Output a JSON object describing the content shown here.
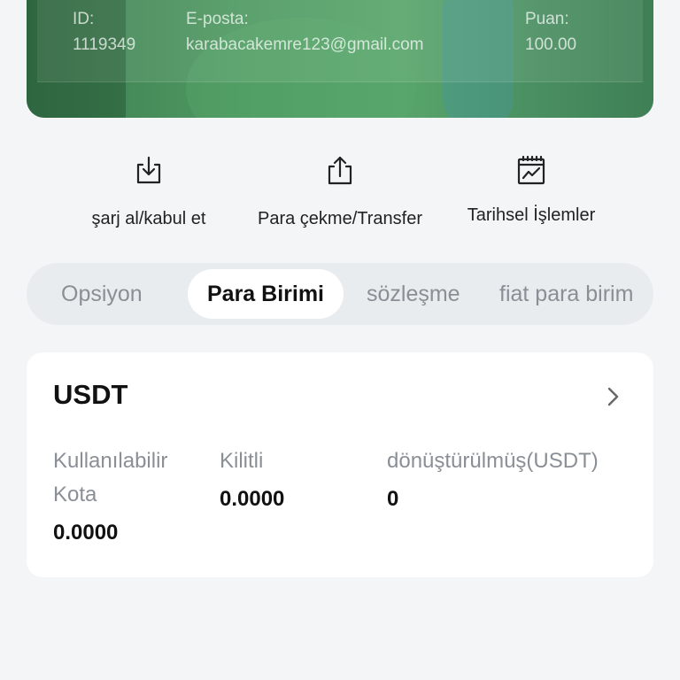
{
  "account": {
    "id_label": "ID:",
    "id_value": "1119349",
    "email_label": "E-posta:",
    "email_value": "karabacakemre123@gmail.com",
    "points_label": "Puan:",
    "points_value": "100.00"
  },
  "actions": [
    {
      "label": "şarj al/kabul et",
      "icon": "download-icon"
    },
    {
      "label": "Para çekme/Transfer",
      "icon": "upload-icon"
    },
    {
      "label": "Tarihsel İşlemler",
      "icon": "chart-calendar-icon"
    }
  ],
  "tabs": [
    {
      "label": "Opsiyon",
      "active": false
    },
    {
      "label": "Para Birimi",
      "active": true
    },
    {
      "label": "sözleşme",
      "active": false
    },
    {
      "label": "fiat para birim",
      "active": false
    }
  ],
  "asset": {
    "name": "USDT",
    "available_label": "Kullanılabilir Kota",
    "available_value": "0.0000",
    "locked_label": "Kilitli",
    "locked_value": "0.0000",
    "converted_label": "dönüştürülmüş(USDT)",
    "converted_value": "0"
  },
  "colors": {
    "card_green": "#4f9a62",
    "background": "#f3f5f7",
    "tab_bg": "#e9ecef"
  }
}
